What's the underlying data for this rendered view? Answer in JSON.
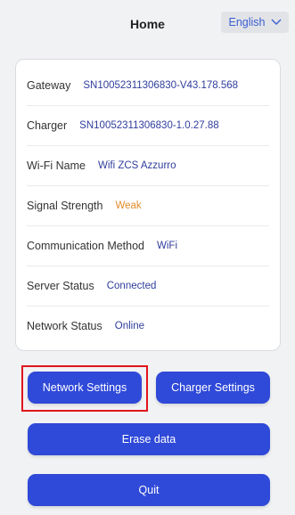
{
  "header": {
    "title": "Home",
    "language": "English"
  },
  "info_rows": [
    {
      "label": "Gateway",
      "value": "SN10052311306830-V43.178.568"
    },
    {
      "label": "Charger",
      "value": "SN10052311306830-1.0.27.88"
    },
    {
      "label": "Wi-Fi Name",
      "value": "Wifi ZCS Azzurro"
    },
    {
      "label": "Signal Strength",
      "value": "Weak"
    },
    {
      "label": "Communication Method",
      "value": "WiFi"
    },
    {
      "label": "Server Status",
      "value": "Connected"
    },
    {
      "label": "Network Status",
      "value": "Online"
    }
  ],
  "buttons": {
    "network_settings": "Network Settings",
    "charger_settings": "Charger Settings",
    "erase_data": "Erase data",
    "quit": "Quit"
  },
  "colors": {
    "accent": "#2f49d8",
    "value_text": "#2f3d9c",
    "warning": "#e08a2a",
    "highlight": "#e0151b"
  }
}
